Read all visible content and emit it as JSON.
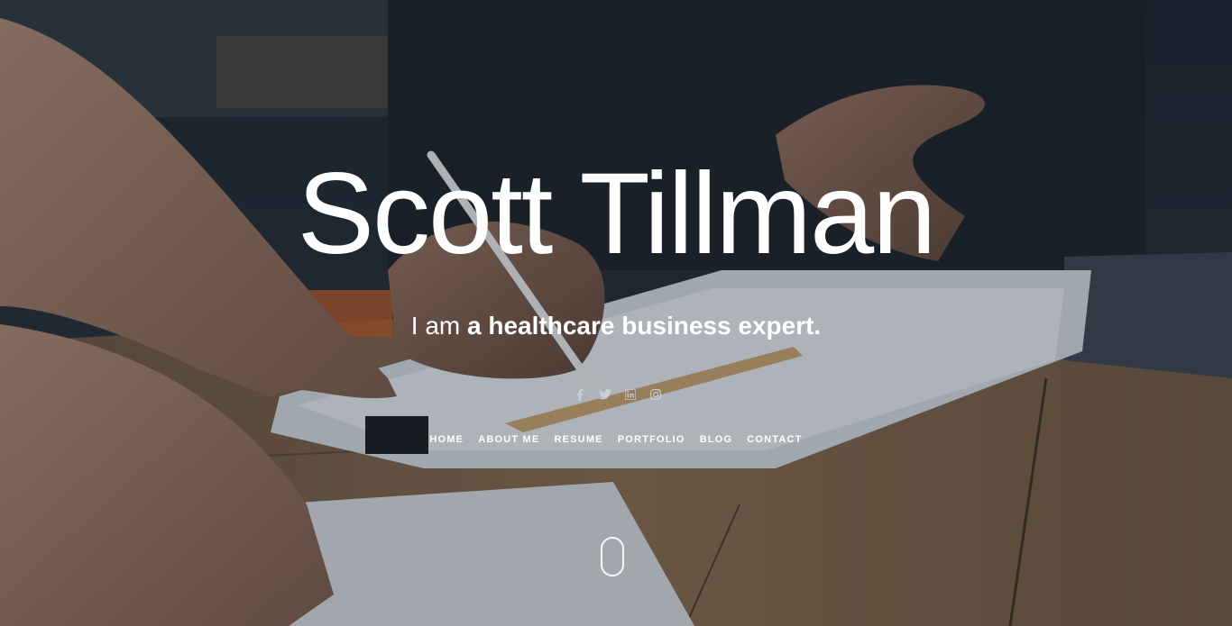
{
  "hero": {
    "name": "Scott Tillman",
    "tagline_lead": "I am ",
    "tagline_strong": "a healthcare business expert."
  },
  "social": [
    {
      "icon": "facebook-icon",
      "label": "f"
    },
    {
      "icon": "twitter-icon",
      "label": "twitter"
    },
    {
      "icon": "linkedin-icon",
      "label": "in"
    },
    {
      "icon": "instagram-icon",
      "label": "instagram"
    }
  ],
  "nav": {
    "home": "HOME",
    "about": "ABOUT ME",
    "resume": "RESUME",
    "portfolio": "PORTFOLIO",
    "blog": "BLOG",
    "contact": "CONTACT"
  },
  "colors": {
    "text": "#ffffff",
    "overlay": "#141c26",
    "icon": "#cfd6dc"
  }
}
